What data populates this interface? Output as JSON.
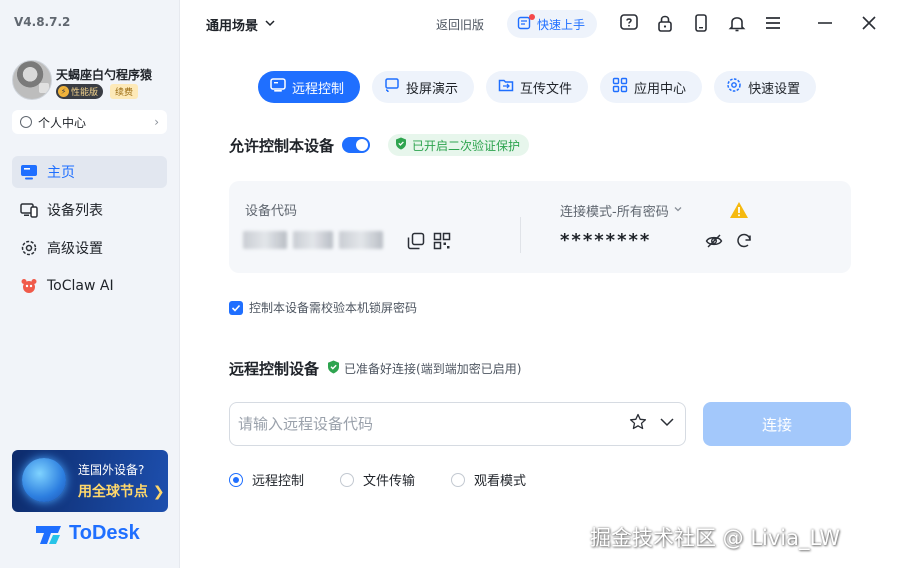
{
  "app": {
    "version": "V4.8.7.2",
    "brand": "ToDesk",
    "accent": "#1f6fff"
  },
  "user": {
    "name": "天蝎座白勺程序猿",
    "perf_badge": "性能版",
    "renew_badge": "续费",
    "personal_center": "个人中心"
  },
  "sidebar": {
    "items": [
      {
        "label": "主页",
        "icon": "monitor-icon",
        "active": true
      },
      {
        "label": "设备列表",
        "icon": "device-list-icon",
        "active": false
      },
      {
        "label": "高级设置",
        "icon": "gear-icon",
        "active": false
      },
      {
        "label": "ToClaw AI",
        "icon": "claw-ai-icon",
        "active": false
      }
    ],
    "promo": {
      "question": "连国外设备?",
      "cta": "用全球节点 ❯"
    }
  },
  "topbar": {
    "scene": "通用场景",
    "old_version": "返回旧版",
    "quick_start": "快速上手"
  },
  "tabs": [
    {
      "label": "远程控制",
      "icon": "remote-control-icon",
      "active": true
    },
    {
      "label": "投屏演示",
      "icon": "screen-cast-icon",
      "active": false
    },
    {
      "label": "互传文件",
      "icon": "file-transfer-icon",
      "active": false
    },
    {
      "label": "应用中心",
      "icon": "app-center-icon",
      "active": false
    },
    {
      "label": "快速设置",
      "icon": "settings-icon",
      "active": false
    }
  ],
  "allow_control": {
    "title": "允许控制本设备",
    "enabled": true,
    "verify_badge": "已开启二次验证保护"
  },
  "device_card": {
    "code_label": "设备代码",
    "mode_label": "连接模式-所有密码",
    "password_mask": "********"
  },
  "lock_option": {
    "label": "控制本设备需校验本机锁屏密码",
    "checked": true
  },
  "remote": {
    "title": "远程控制设备",
    "status": "已准备好连接(端到端加密已启用)",
    "input_placeholder": "请输入远程设备代码",
    "connect_label": "连接"
  },
  "modes": [
    {
      "label": "远程控制",
      "selected": true
    },
    {
      "label": "文件传输",
      "selected": false
    },
    {
      "label": "观看模式",
      "selected": false
    }
  ],
  "watermark": "掘金技术社区 @ Livia_LW"
}
